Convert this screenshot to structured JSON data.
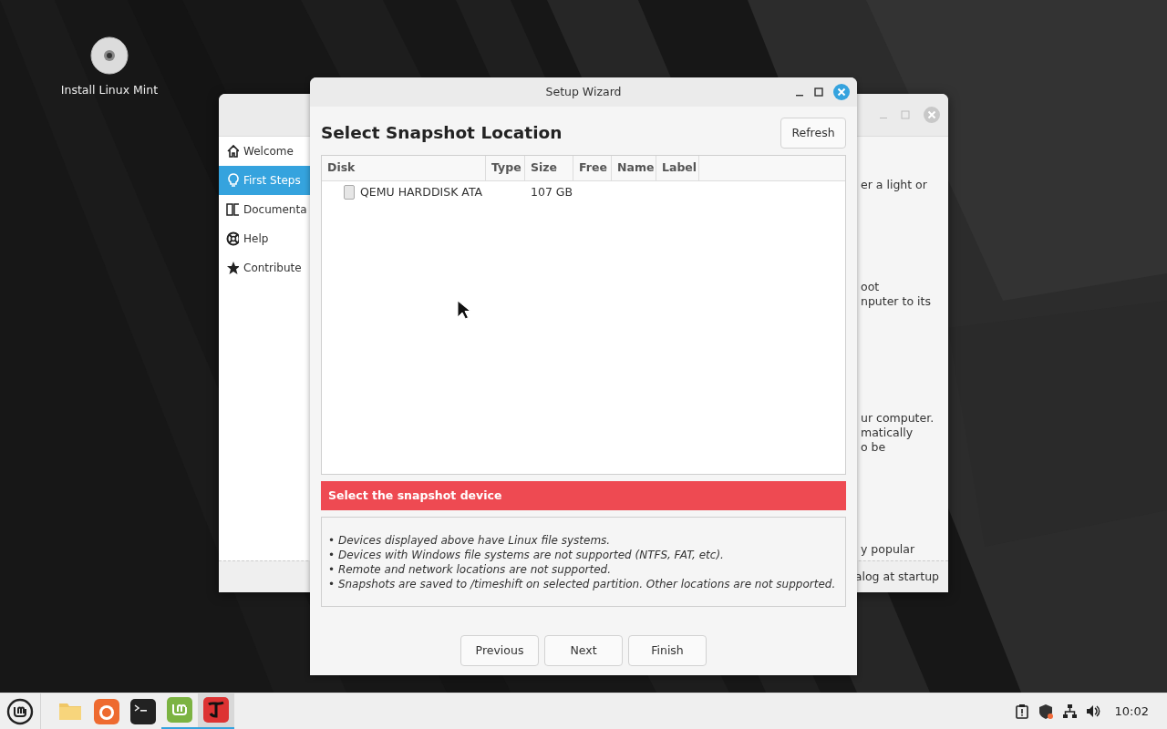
{
  "desktop": {
    "icons": [
      {
        "label": "Install Linux Mint"
      }
    ]
  },
  "welcome_window": {
    "sidebar": [
      {
        "label": "Welcome",
        "selected": false
      },
      {
        "label": "First Steps",
        "selected": true
      },
      {
        "label": "Documenta",
        "selected": false
      },
      {
        "label": "Help",
        "selected": false
      },
      {
        "label": "Contribute",
        "selected": false
      }
    ],
    "content": [
      [
        "er a light or"
      ],
      [
        "oot",
        "nputer to its"
      ],
      [
        "ur computer.",
        "matically",
        "o be"
      ],
      [
        "y popular"
      ]
    ],
    "footer": "alog at startup"
  },
  "wizard": {
    "title": "Setup Wizard",
    "heading": "Select Snapshot Location",
    "refresh": "Refresh",
    "table": {
      "columns": [
        "Disk",
        "Type",
        "Size",
        "Free",
        "Name",
        "Label"
      ],
      "rows": [
        {
          "disk": "QEMU HARDDISK ATA",
          "size": "107 GB"
        }
      ]
    },
    "message": "Select the snapshot device",
    "notes": [
      "• Devices displayed above have Linux file systems.",
      "• Devices with Windows file systems are not supported (NTFS, FAT, etc).",
      "• Remote and network locations are not supported.",
      "• Snapshots are saved to /timeshift on selected partition. Other locations are not supported."
    ],
    "buttons": [
      "Previous",
      "Next",
      "Finish"
    ]
  },
  "taskbar": {
    "apps": [
      {
        "kind": "files",
        "running": false,
        "focused": false
      },
      {
        "kind": "browser",
        "running": false,
        "focused": false
      },
      {
        "kind": "terminal",
        "running": false,
        "focused": false
      },
      {
        "kind": "welcome",
        "running": true,
        "focused": false
      },
      {
        "kind": "timeshift",
        "running": true,
        "focused": true
      }
    ],
    "clock": "10:02"
  }
}
